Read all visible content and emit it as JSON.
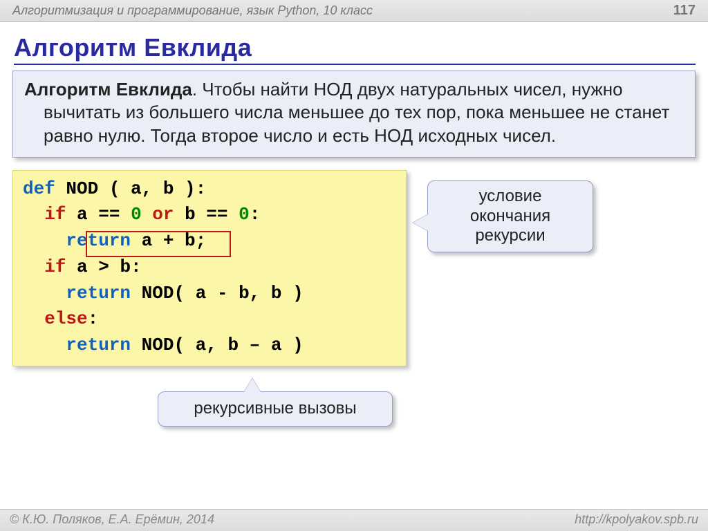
{
  "header": {
    "breadcrumb": "Алгоритмизация и программирование, язык Python, 10 класс",
    "page_number": "117"
  },
  "title": "Алгоритм Евклида",
  "theory": {
    "lead": "Алгоритм Евклида",
    "text": ". Чтобы найти НОД двух натуральных чисел, нужно вычитать из большего числа меньшее до тех пор, пока меньшее не станет равно нулю. Тогда второе число и есть НОД исходных чисел."
  },
  "code": {
    "l1_def": "def",
    "l1_rest": " NOD ( a, b ):",
    "l2_if": "if",
    "l2_mid1": " a == ",
    "l2_zero": "0",
    "l2_or": " or ",
    "l2_mid2": "b == ",
    "l2_zero2": "0",
    "l2_colon": ":",
    "l3_ret": "return",
    "l3_rest": " a + b;",
    "l4_if": "if",
    "l4_rest": " a > b:",
    "l5_ret": "return",
    "l5_rest": " NOD( a - b, b )",
    "l6_else": "else",
    "l6_colon": ":",
    "l7_ret": "return",
    "l7_rest": " NOD( a, b – a )"
  },
  "callouts": {
    "right_l1": "условие",
    "right_l2": "окончания",
    "right_l3": "рекурсии",
    "bottom": "рекурсивные вызовы"
  },
  "footer": {
    "copyright": "© К.Ю. Поляков, Е.А. Ерёмин, 2014",
    "url": "http://kpolyakov.spb.ru"
  }
}
